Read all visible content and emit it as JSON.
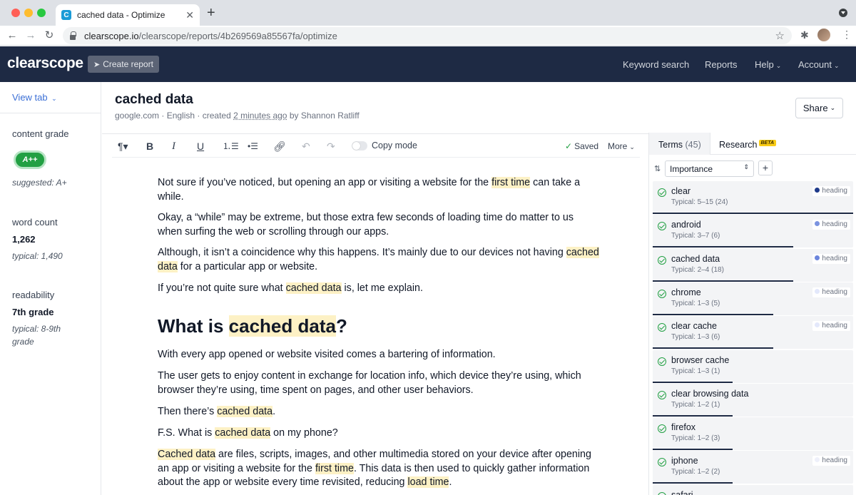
{
  "browser": {
    "tab_title": "cached data - Optimize",
    "favicon_letter": "C",
    "url_host": "clearscope.io",
    "url_path": "/clearscope/reports/4b269569a85567fa/optimize"
  },
  "header": {
    "logo": "clearscope",
    "create_report": "Create report",
    "nav": {
      "keyword_search": "Keyword search",
      "reports": "Reports",
      "help": "Help",
      "account": "Account"
    }
  },
  "sidebar": {
    "view_tab": "View tab",
    "content_grade_label": "content grade",
    "grade": "A++",
    "suggested": "suggested: A+",
    "word_count_label": "word count",
    "word_count": "1,262",
    "word_count_typical": "typical: 1,490",
    "readability_label": "readability",
    "readability": "7th grade",
    "readability_typical": "typical: 8-9th grade"
  },
  "document": {
    "title": "cached data",
    "meta_prefix": "google.com · English · created ",
    "meta_time": "2 minutes ago",
    "meta_suffix": " by Shannon Ratliff",
    "share": "Share"
  },
  "editor_toolbar": {
    "copy_mode": "Copy mode",
    "saved": "Saved",
    "more": "More"
  },
  "content": {
    "p1a": "Not sure if you’ve noticed, but opening an app or visiting a website for the ",
    "p1b": "first time",
    "p1c": " can take a while.",
    "p2": "Okay, a “while” may be extreme, but those extra few seconds of loading time do matter to us when surfing the web or scrolling through our apps.",
    "p3a": "Although, it isn’t a coincidence why this happens. It’s mainly due to our devices not having ",
    "p3b": "cached data",
    "p3c": " for a particular app or website.",
    "p4a": "If you’re not quite sure what ",
    "p4b": "cached data",
    "p4c": " is, let me explain.",
    "h2a": "What is ",
    "h2b": "cached data",
    "h2c": "?",
    "p5": "With every app opened or website visited comes a bartering of information.",
    "p6": "The user gets to enjoy content in exchange for location info, which device they’re using, which browser they’re using, time spent on pages, and other user behaviors.",
    "p7a": "Then there’s ",
    "p7b": "cached data",
    "p7c": ".",
    "p8a": "F.S. What is ",
    "p8b": "cached data",
    "p8c": " on my phone?",
    "p9a": "Cached data",
    "p9b": " are files, scripts, images, and other multimedia stored on your device after opening an app or visiting a website for the ",
    "p9c": "first time",
    "p9d": ". This data is then used to quickly gather information about the app or website every time revisited, reducing ",
    "p9e": "load time",
    "p9f": "."
  },
  "terms_panel": {
    "tab_terms": "Terms",
    "terms_count": "(45)",
    "tab_research": "Research",
    "beta": "BETA",
    "sort": "Importance",
    "add": "+",
    "badge_label": "heading",
    "items": [
      {
        "name": "clear",
        "typical": "Typical: 5–15 (24)",
        "heading": true,
        "dot": "#1e3a8a",
        "progress": 1.0
      },
      {
        "name": "android",
        "typical": "Typical: 3–7 (6)",
        "heading": true,
        "dot": "#7b93e0",
        "progress": 0.7
      },
      {
        "name": "cached data",
        "typical": "Typical: 2–4 (18)",
        "heading": true,
        "dot": "#6b85dc",
        "progress": 0.7
      },
      {
        "name": "chrome",
        "typical": "Typical: 1–3 (5)",
        "heading": true,
        "dot": "#e3e8fb",
        "progress": 0.6
      },
      {
        "name": "clear cache",
        "typical": "Typical: 1–3 (6)",
        "heading": true,
        "dot": "#e3e8fb",
        "progress": 0.6
      },
      {
        "name": "browser cache",
        "typical": "Typical: 1–3 (1)",
        "heading": false,
        "progress": 0.4
      },
      {
        "name": "clear browsing data",
        "typical": "Typical: 1–2 (1)",
        "heading": false,
        "progress": 0.4
      },
      {
        "name": "firefox",
        "typical": "Typical: 1–2 (3)",
        "heading": false,
        "progress": 0.4
      },
      {
        "name": "iphone",
        "typical": "Typical: 1–2 (2)",
        "heading": true,
        "dot": "#eef0fa",
        "progress": 0.4
      },
      {
        "name": "safari",
        "typical": "",
        "heading": false,
        "progress": 0.4
      }
    ]
  }
}
